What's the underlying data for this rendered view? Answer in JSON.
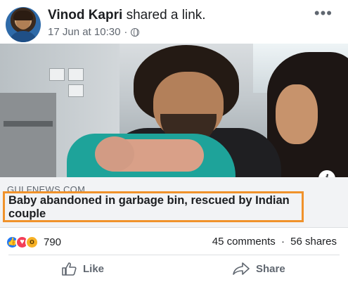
{
  "post": {
    "author_name": "Vinod Kapri",
    "action_text": "shared a link.",
    "timestamp": "17 Jun at 10:30",
    "separator": "·",
    "privacy_icon": "globe-icon",
    "more_icon": "more-options-icon"
  },
  "link": {
    "domain": "GULFNEWS.COM",
    "title": "Baby abandoned in garbage bin, rescued by Indian couple",
    "info_icon_label": "i"
  },
  "stats": {
    "reactions": [
      "like",
      "love",
      "wow"
    ],
    "reaction_count": "790",
    "comments": "45 comments",
    "separator": "·",
    "shares": "56 shares"
  },
  "actions": {
    "like_label": "Like",
    "share_label": "Share"
  },
  "colors": {
    "highlight_border": "#f0922b",
    "like_blue": "#2078f4",
    "love_red": "#f33e58",
    "wow_yellow": "#f7b125"
  }
}
